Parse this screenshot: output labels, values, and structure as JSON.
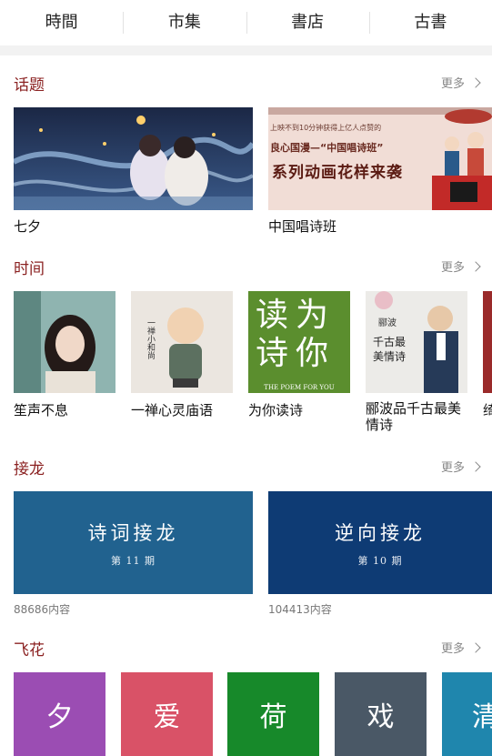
{
  "nav": {
    "tabs": [
      {
        "label": "時間"
      },
      {
        "label": "市集"
      },
      {
        "label": "書店"
      },
      {
        "label": "古書"
      }
    ]
  },
  "more_label": "更多",
  "topics": {
    "title": "话题",
    "items": [
      {
        "caption": "七夕"
      },
      {
        "caption": "中国唱诗班",
        "banner_line1": "上映不到10分钟获得上亿人点赞的",
        "banner_line2": "良心国漫—“中国唱诗班”",
        "banner_line3": "系列动画花样来袭"
      }
    ]
  },
  "time": {
    "title": "时间",
    "items": [
      {
        "caption": "笙声不息"
      },
      {
        "caption": "一禅心灵庙语",
        "art": "一禅小和尚"
      },
      {
        "caption": "为你读诗",
        "art_big": "读为诗你",
        "art_en": "THE POEM FOR YOU"
      },
      {
        "caption": "郦波品千古最美情诗",
        "art": "郦波",
        "art2": "千古最美情诗"
      },
      {
        "caption": "绮"
      }
    ]
  },
  "jielong": {
    "title": "接龙",
    "items": [
      {
        "title": "诗词接龙",
        "period": "第 11 期",
        "count": "88686内容",
        "color": "#21628f"
      },
      {
        "title": "逆向接龙",
        "period": "第 10 期",
        "count": "104413内容",
        "color": "#0e3b74"
      }
    ]
  },
  "feihua": {
    "title": "飞花",
    "items": [
      {
        "char": "夕",
        "color": "#9b4db3"
      },
      {
        "char": "爱",
        "color": "#d95267"
      },
      {
        "char": "荷",
        "color": "#17892a"
      },
      {
        "char": "戏",
        "color": "#4a5866"
      },
      {
        "char": "清",
        "color": "#1f86ad"
      }
    ]
  }
}
